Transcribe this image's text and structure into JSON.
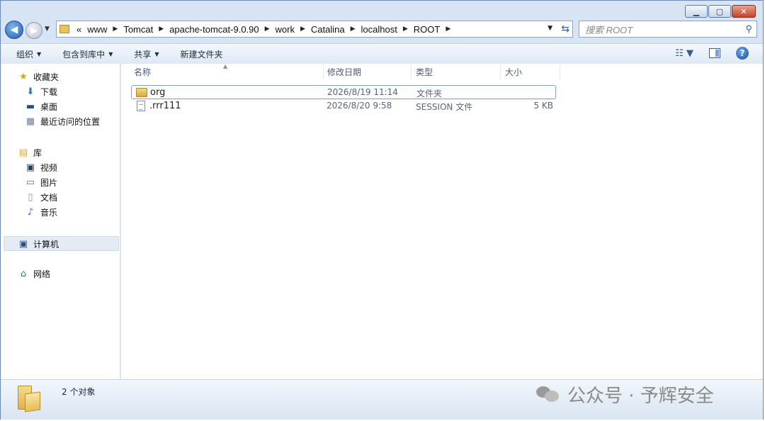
{
  "breadcrumb": {
    "overflow": "«",
    "parts": [
      "www",
      "Tomcat",
      "apache-tomcat-9.0.90",
      "work",
      "Catalina",
      "localhost",
      "ROOT"
    ]
  },
  "search": {
    "placeholder": "搜索 ROOT"
  },
  "toolbar": {
    "organize": "组织",
    "include_in_library": "包含到库中",
    "share": "共享",
    "new_folder": "新建文件夹"
  },
  "nav": {
    "favorites": "收藏夹",
    "downloads": "下载",
    "desktop": "桌面",
    "recent": "最近访问的位置",
    "libraries": "库",
    "videos": "视频",
    "pictures": "图片",
    "documents": "文档",
    "music": "音乐",
    "computer": "计算机",
    "network": "网络"
  },
  "columns": {
    "name": "名称",
    "modified": "修改日期",
    "type": "类型",
    "size": "大小"
  },
  "files": [
    {
      "name": "org",
      "modified": "2026/8/19 11:14",
      "type": "文件夹",
      "size": "",
      "icon": "folder-icon"
    },
    {
      "name": ".rrr111",
      "modified": "2026/8/20 9:58",
      "type": "SESSION 文件",
      "size": "5 KB",
      "icon": "file-icon"
    }
  ],
  "status": {
    "count_text": "2 个对象"
  },
  "watermark": {
    "text": "公众号 · 予辉安全"
  },
  "colors": {
    "accent": "#1e5db5",
    "toolbar_bg": "#dde8f4",
    "selection_border": "#7da2ce"
  }
}
